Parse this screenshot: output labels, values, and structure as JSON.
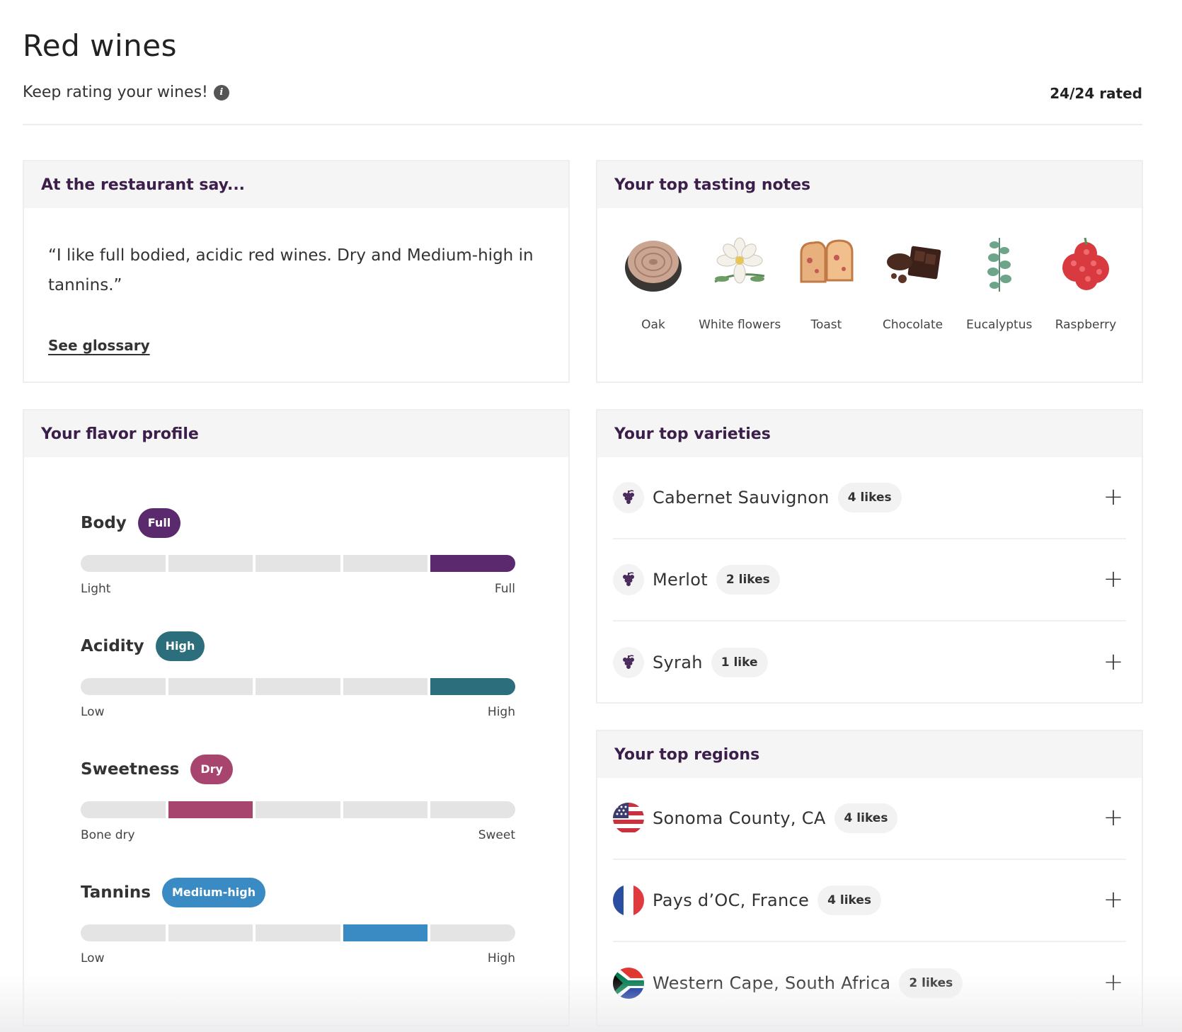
{
  "header": {
    "title": "Red wines",
    "subtitle": "Keep rating your wines!",
    "info_icon": "i",
    "rated": "24/24 rated"
  },
  "restaurant": {
    "heading": "At the restaurant say...",
    "quote": "“I like full bodied, acidic red wines. Dry and Medium-high in tannins.”",
    "glossary_link": "See glossary"
  },
  "tasting_notes": {
    "heading": "Your top tasting notes",
    "items": [
      {
        "label": "Oak",
        "icon": "oak-icon"
      },
      {
        "label": "White flowers",
        "icon": "white-flowers-icon"
      },
      {
        "label": "Toast",
        "icon": "toast-icon"
      },
      {
        "label": "Chocolate",
        "icon": "chocolate-icon"
      },
      {
        "label": "Eucalyptus",
        "icon": "eucalyptus-icon"
      },
      {
        "label": "Raspberry",
        "icon": "raspberry-icon"
      }
    ]
  },
  "flavor_profile": {
    "heading": "Your flavor profile",
    "segments_total": 5,
    "traits": [
      {
        "name": "Body",
        "level": "Full",
        "color": "#5b2a6e",
        "filled_segments": [
          5
        ],
        "low_label": "Light",
        "high_label": "Full"
      },
      {
        "name": "Acidity",
        "level": "High",
        "color": "#2c6e7b",
        "filled_segments": [
          5
        ],
        "low_label": "Low",
        "high_label": "High"
      },
      {
        "name": "Sweetness",
        "level": "Dry",
        "color": "#a8456f",
        "filled_segments": [
          2
        ],
        "low_label": "Bone dry",
        "high_label": "Sweet"
      },
      {
        "name": "Tannins",
        "level": "Medium-high",
        "color": "#3a8ac4",
        "filled_segments": [
          4
        ],
        "low_label": "Low",
        "high_label": "High"
      }
    ]
  },
  "varieties": {
    "heading": "Your top varieties",
    "items": [
      {
        "name": "Cabernet Sauvignon",
        "likes": "4 likes",
        "icon": "grape-icon"
      },
      {
        "name": "Merlot",
        "likes": "2 likes",
        "icon": "grape-icon"
      },
      {
        "name": "Syrah",
        "likes": "1 like",
        "icon": "grape-icon"
      }
    ]
  },
  "regions": {
    "heading": "Your top regions",
    "items": [
      {
        "name": "Sonoma County, CA",
        "likes": "4 likes",
        "icon": "us-flag-icon"
      },
      {
        "name": "Pays d’OC, France",
        "likes": "4 likes",
        "icon": "france-flag-icon"
      },
      {
        "name": "Western Cape, South Africa",
        "likes": "2 likes",
        "icon": "south-africa-flag-icon"
      }
    ]
  },
  "colors": {
    "heading_text": "#3b1f4a",
    "card_header_bg": "#f5f5f6",
    "bar_empty": "#e4e4e4"
  }
}
